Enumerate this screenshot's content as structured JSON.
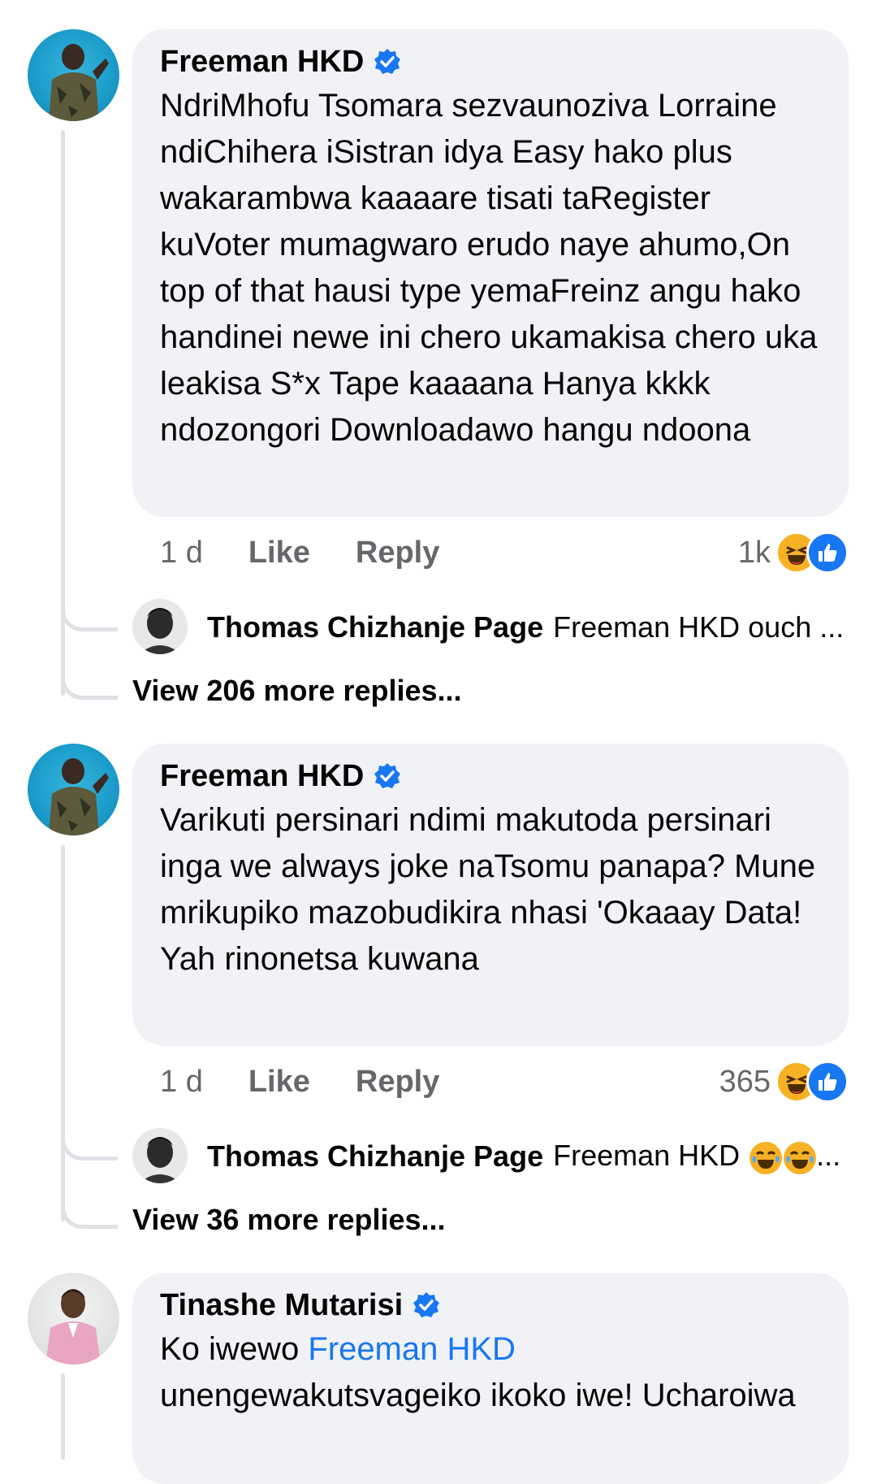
{
  "comments": [
    {
      "author": "Freeman HKD",
      "text": "NdriMhofu Tsomara sezvaunoziva Lorraine  ndiChihera iSistran idya Easy hako plus wakarambwa kaaaare tisati taRegister kuVoter mumagwaro erudo naye ahumo,On top of that hausi type yemaFreinz angu hako handinei newe ini chero ukamakisa chero uka leakisa S*x Tape kaaaana Hanya kkkk ndozongori Downloadawo hangu ndoona",
      "time": "1 d",
      "like_label": "Like",
      "reply_label": "Reply",
      "reaction_count": "1k",
      "reactions": [
        "haha-icon",
        "like-icon"
      ],
      "reply_preview": {
        "author": "Thomas Chizhanje Page",
        "text": "Freeman HKD ouch ..."
      },
      "view_more": "View 206 more replies..."
    },
    {
      "author": "Freeman HKD",
      "text": "Varikuti persinari ndimi makutoda persinari inga we always  joke naTsomu panapa? Mune mrikupiko mazobudikira nhasi 'Okaaay Data! Yah rinonetsa kuwana",
      "time": "1 d",
      "like_label": "Like",
      "reply_label": "Reply",
      "reaction_count": "365",
      "reactions": [
        "haha-icon",
        "like-icon"
      ],
      "reply_preview": {
        "author": "Thomas Chizhanje Page",
        "text": "Freeman HKD",
        "suffix": "..."
      },
      "view_more": "View 36 more replies..."
    },
    {
      "author": "Tinashe Mutarisi",
      "text_prefix": "Ko iwewo ",
      "mention": "Freeman HKD",
      "text": "unengewakutsvageiko ikoko iwe! Ucharoiwa"
    }
  ],
  "colors": {
    "bubble": "#f0f2f5",
    "meta": "#65676b",
    "accent": "#1877f2",
    "haha": "#f7b125",
    "thread": "#dfe1e5"
  }
}
